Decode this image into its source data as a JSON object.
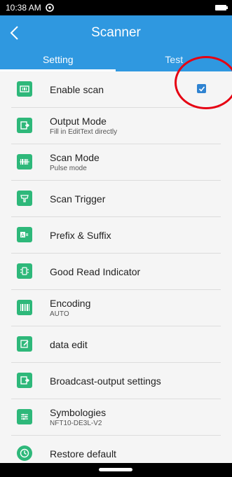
{
  "status_bar": {
    "time": "10:38 AM"
  },
  "app_bar": {
    "title": "Scanner"
  },
  "tabs": [
    {
      "label": "Setting"
    },
    {
      "label": "Test"
    }
  ],
  "items": [
    {
      "label": "Enable scan",
      "sub": "",
      "icon": "scan-icon"
    },
    {
      "label": "Output Mode",
      "sub": "Fill in EditText directly",
      "icon": "output-icon"
    },
    {
      "label": "Scan Mode",
      "sub": "Pulse mode",
      "icon": "scan-mode-icon"
    },
    {
      "label": "Scan Trigger",
      "sub": "",
      "icon": "trigger-icon"
    },
    {
      "label": "Prefix & Suffix",
      "sub": "",
      "icon": "prefix-icon"
    },
    {
      "label": "Good Read Indicator",
      "sub": "",
      "icon": "indicator-icon"
    },
    {
      "label": "Encoding",
      "sub": "AUTO",
      "icon": "barcode-icon"
    },
    {
      "label": "data edit",
      "sub": "",
      "icon": "edit-icon"
    },
    {
      "label": "Broadcast-output settings",
      "sub": "",
      "icon": "broadcast-icon"
    },
    {
      "label": "Symbologies",
      "sub": "NFT10-DE3L-V2",
      "icon": "symbologies-icon"
    },
    {
      "label": "Restore default",
      "sub": "",
      "icon": "clock-icon"
    }
  ],
  "enable_scan_checked": true,
  "colors": {
    "accent": "#2f98e0",
    "icon_green": "#2eb87a",
    "checkbox": "#2f83d1",
    "highlight": "#e60012"
  }
}
